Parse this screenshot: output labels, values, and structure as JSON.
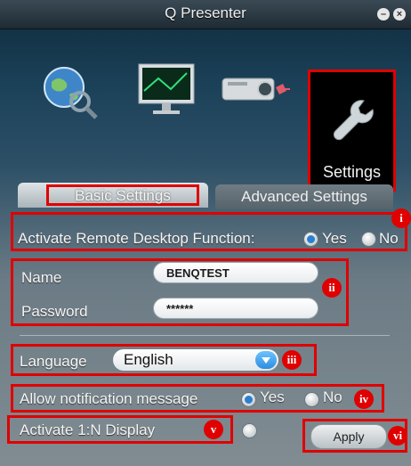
{
  "window": {
    "title": "Q Presenter"
  },
  "toolbar": {
    "items": [
      {
        "name": "network-search",
        "label": ""
      },
      {
        "name": "display",
        "label": ""
      },
      {
        "name": "projector",
        "label": ""
      },
      {
        "name": "settings",
        "label": "Settings"
      }
    ]
  },
  "tabs": {
    "basic": "Basic Settings",
    "advanced": "Advanced Settings"
  },
  "remote_desktop": {
    "label": "Activate Remote Desktop Function:",
    "yes": "Yes",
    "no": "No",
    "selected": "Yes"
  },
  "credentials": {
    "name_label": "Name",
    "name_value": "BENQTEST",
    "password_label": "Password",
    "password_value": "******"
  },
  "language": {
    "label": "Language",
    "selected": "English"
  },
  "notification": {
    "label": "Allow notification message",
    "yes": "Yes",
    "no": "No",
    "selected": "Yes"
  },
  "display_1n": {
    "label": "Activate 1:N Display"
  },
  "apply_label": "Apply",
  "markers": {
    "i": "i",
    "ii": "ii",
    "iii": "iii",
    "iv": "iv",
    "v": "v",
    "vi": "vi"
  },
  "colors": {
    "highlight_box": "#e00000",
    "radio_on": "#2a7fd1",
    "dropdown_arrow": "#2d8ee0"
  }
}
